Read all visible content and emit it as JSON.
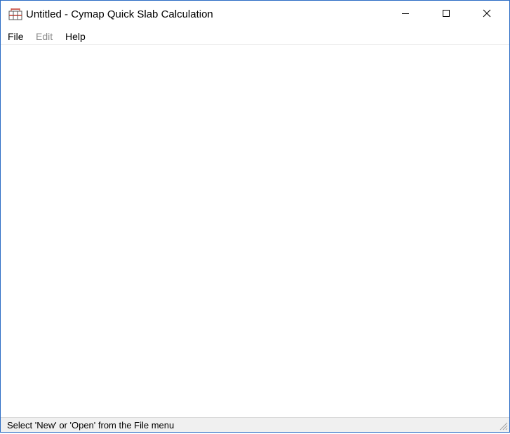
{
  "window": {
    "title": "Untitled - Cymap Quick Slab Calculation",
    "icon": "cymap-app-icon",
    "controls": {
      "minimize": "minimize-icon",
      "maximize": "maximize-icon",
      "close": "close-icon"
    }
  },
  "menubar": {
    "items": [
      {
        "label": "File",
        "enabled": true
      },
      {
        "label": "Edit",
        "enabled": false
      },
      {
        "label": "Help",
        "enabled": true
      }
    ]
  },
  "statusbar": {
    "text": "Select 'New' or 'Open' from the File menu"
  },
  "colors": {
    "window_border": "#2b6cc4",
    "disabled_text": "#8c8c8c",
    "statusbar_bg": "#f0f0f0",
    "icon_red": "#c0392b"
  }
}
